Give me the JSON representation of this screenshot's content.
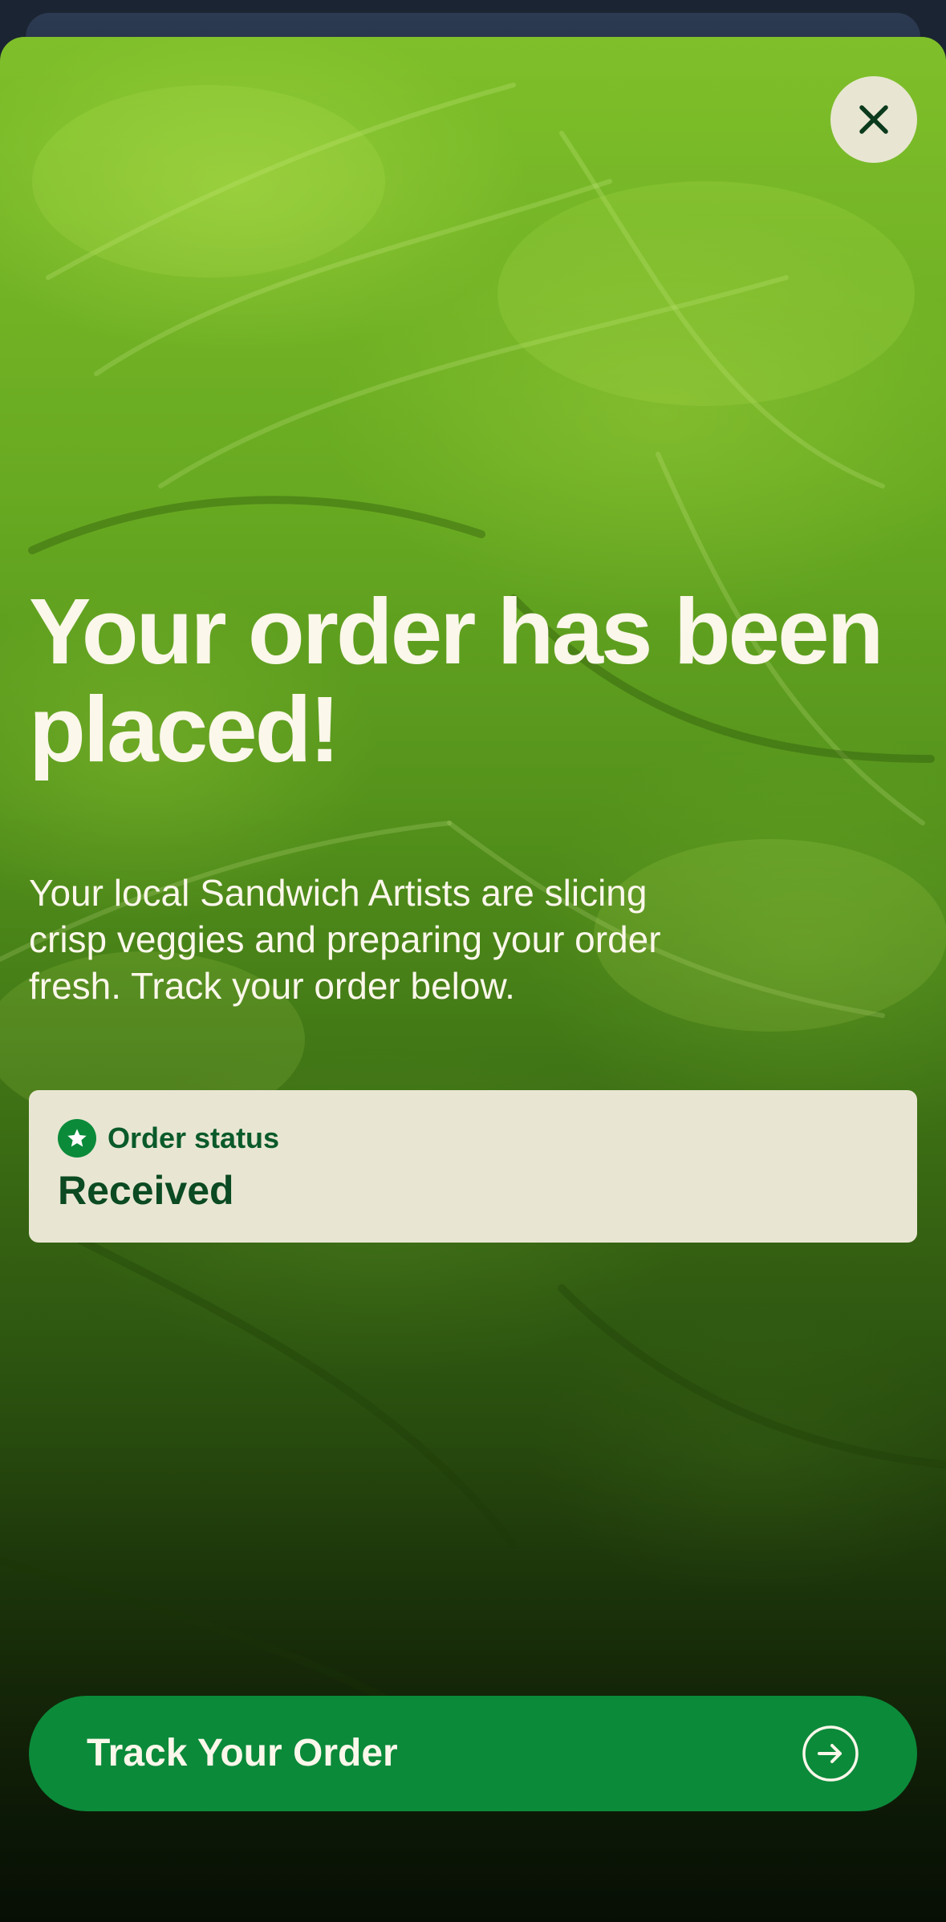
{
  "modal": {
    "headline": "Your order has been placed!",
    "subtext": "Your local Sandwich Artists are slicing crisp veggies and preparing your order fresh. Track your order below.",
    "close_icon": "close-icon"
  },
  "order_status": {
    "label": "Order status",
    "value": "Received",
    "icon": "star-icon"
  },
  "track_button": {
    "label": "Track Your Order",
    "icon": "arrow-right-circle-icon"
  },
  "colors": {
    "brand_green": "#0b8a3a",
    "card_bg": "#e8e6d2",
    "text_light": "#fbf7ea",
    "status_text": "#0b4a22"
  }
}
